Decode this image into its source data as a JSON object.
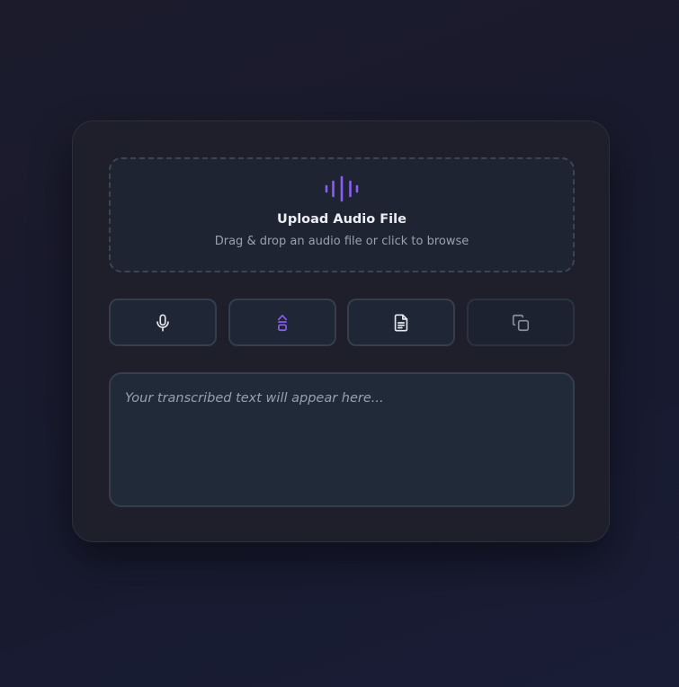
{
  "upload": {
    "title": "Upload Audio File",
    "subtitle": "Drag & drop an audio file or click to browse",
    "icon": "audio-wave-icon"
  },
  "actions": [
    {
      "name": "record",
      "icon": "microphone-icon",
      "enabled": true
    },
    {
      "name": "transcribe",
      "icon": "transcribe-icon",
      "enabled": true
    },
    {
      "name": "export",
      "icon": "document-icon",
      "enabled": true
    },
    {
      "name": "copy",
      "icon": "copy-icon",
      "enabled": false
    }
  ],
  "output": {
    "placeholder": "Your transcribed text will appear here..."
  },
  "colors": {
    "accent": "#8b5cf6",
    "card": "#1f1e2b",
    "panel": "#1f2433"
  }
}
